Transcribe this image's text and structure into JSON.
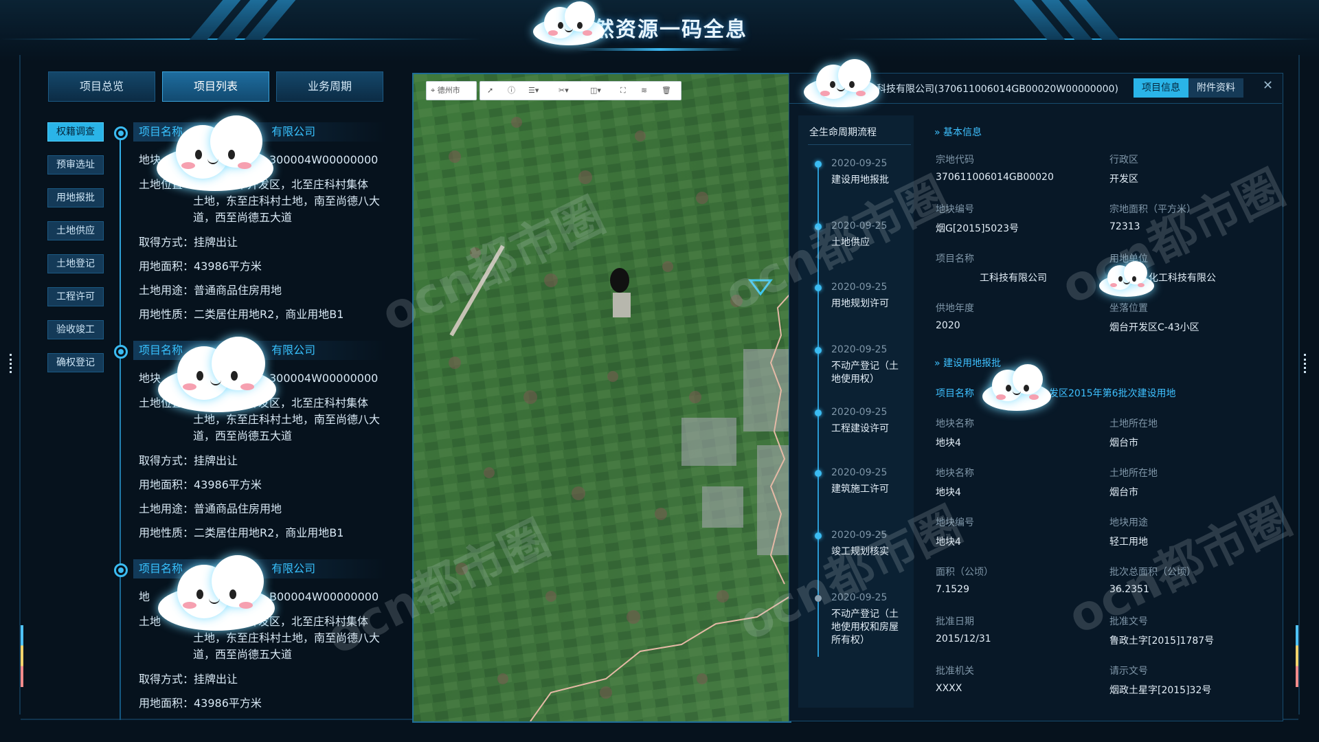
{
  "header": {
    "title": "自然资源一码全息"
  },
  "left": {
    "tabs": [
      "项目总览",
      "项目列表",
      "业务周期"
    ],
    "active_tab": "项目列表",
    "side_buttons": [
      "权籍调查",
      "预审选址",
      "用地报批",
      "土地供应",
      "土地登记",
      "工程许可",
      "验收竣工",
      "确权登记"
    ],
    "projects": [
      {
        "name_label": "项目名称",
        "name_suffix": "有限公司",
        "code_prefix": "地块",
        "code_suffix": "300004W00000000",
        "loc_prefix": "土地位置",
        "loc_line1": "术开发区，北至庄科村集体",
        "loc_line2": "土地，东至庄科村土地，南至尚德八大",
        "loc_line3": "道，西至尚德五大道",
        "acq": "取得方式：挂牌出让",
        "area": "用地面积：43986平方米",
        "use": "土地用途：普通商品住房用地",
        "nature": "用地性质：二类居住用地R2，商业用地B1"
      },
      {
        "name_label": "项目名称",
        "name_suffix": "有限公司",
        "code_prefix": "地块",
        "code_suffix": "300004W00000000",
        "loc_prefix": "土地位置",
        "loc_line1": "术开发区，北至庄科村集体",
        "loc_line2": "土地，东至庄科村土地，南至尚德八大",
        "loc_line3": "道，西至尚德五大道",
        "acq": "取得方式：挂牌出让",
        "area": "用地面积：43986平方米",
        "use": "土地用途：普通商品住房用地",
        "nature": "用地性质：二类居住用地R2，商业用地B1"
      },
      {
        "name_label": "项目名称",
        "name_suffix": "有限公司",
        "code_prefix": "地",
        "code_suffix": "B00004W00000000",
        "loc_prefix": "土地",
        "loc_line1": "术开发区，北至庄科村集体",
        "loc_line2": "土地，东至庄科村土地，南至尚德八大",
        "loc_line3": "道，西至尚德五大道",
        "acq": "取得方式：挂牌出让",
        "area": "用地面积：43986平方米"
      }
    ]
  },
  "map": {
    "city_label": "德州市",
    "tools": [
      "select-icon",
      "info-icon",
      "list-icon",
      "measure-icon",
      "split-icon",
      "frame-icon",
      "layers-icon",
      "delete-icon"
    ]
  },
  "right": {
    "header_text": "科技有限公司(370611006014GB00020W00000000)",
    "tabs": [
      "项目信息",
      "附件资料"
    ],
    "active_tab": "项目信息",
    "lifecycle_title": "全生命周期流程",
    "steps": [
      {
        "date": "2020-09-25",
        "name": "建设用地报批"
      },
      {
        "date": "2020-09-25",
        "name": "土地供应"
      },
      {
        "date": "2020-09-25",
        "name": "用地规划许可"
      },
      {
        "date": "2020-09-25",
        "name": "不动产登记（土地使用权）"
      },
      {
        "date": "2020-09-25",
        "name": "工程建设许可"
      },
      {
        "date": "2020-09-25",
        "name": "建筑施工许可"
      },
      {
        "date": "2020-09-25",
        "name": "竣工规划核实"
      },
      {
        "date": "2020-09-25",
        "name": "不动产登记（土地使用权和房屋所有权）"
      }
    ],
    "basic": {
      "title": "基本信息",
      "fields": [
        {
          "label": "宗地代码",
          "value": "370611006014GB00020"
        },
        {
          "label": "行政区",
          "value": "开发区"
        },
        {
          "label": "地块编号",
          "value": "烟G[2015]5023号"
        },
        {
          "label": "宗地面积（平方米）",
          "value": "72313"
        },
        {
          "label": "项目名称",
          "value": "工科技有限公司"
        },
        {
          "label": "用地单位",
          "value": "化工科技有限公"
        },
        {
          "label": "供地年度",
          "value": "2020"
        },
        {
          "label": "坐落位置",
          "value": "烟台开发区C-43小区"
        }
      ]
    },
    "approval": {
      "title": "建设用地报批",
      "project_label": "项目名称",
      "project_value": "发区2015年第6批次建设用地",
      "fields": [
        {
          "label": "地块名称",
          "value": "地块4"
        },
        {
          "label": "土地所在地",
          "value": "烟台市"
        },
        {
          "label": "地块名称",
          "value": "地块4"
        },
        {
          "label": "土地所在地",
          "value": "烟台市"
        },
        {
          "label": "地块编号",
          "value": "地块4"
        },
        {
          "label": "地块用途",
          "value": "轻工用地"
        },
        {
          "label": "面积（公顷）",
          "value": "7.1529"
        },
        {
          "label": "批次总面积（公顷）",
          "value": "36.2351"
        },
        {
          "label": "批准日期",
          "value": "2015/12/31"
        },
        {
          "label": "批准文号",
          "value": "鲁政土字[2015]1787号"
        },
        {
          "label": "批准机关",
          "value": "XXXX"
        },
        {
          "label": "请示文号",
          "value": "烟政土星字[2015]32号"
        }
      ]
    }
  },
  "watermark": "ocn都市圈"
}
